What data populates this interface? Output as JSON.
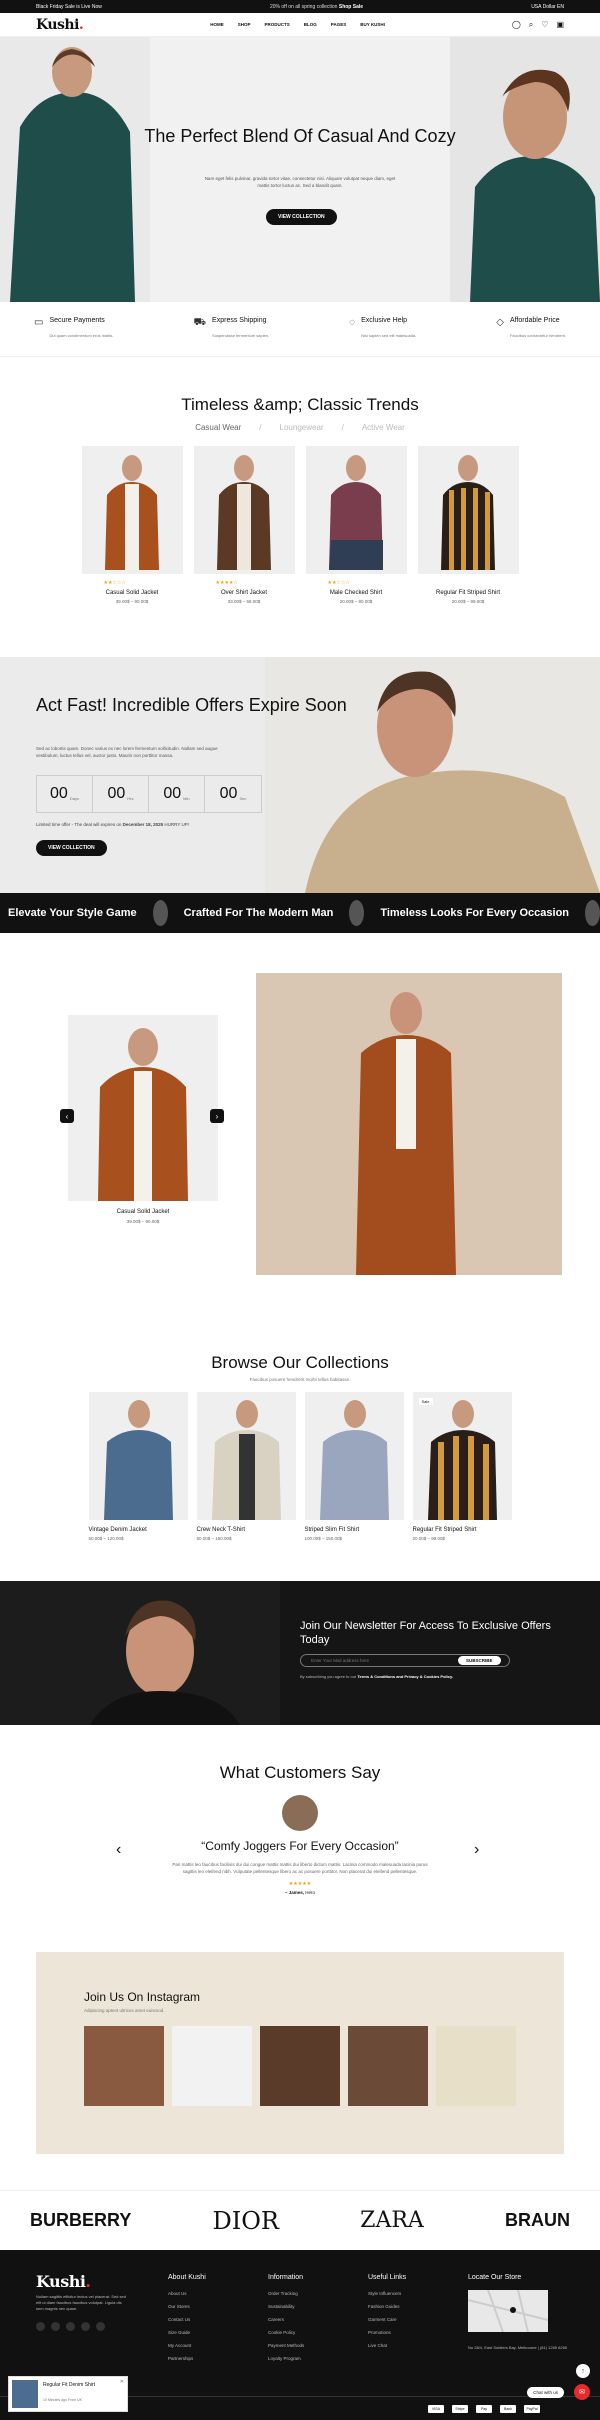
{
  "topbar": {
    "left": "Black Friday Sale is Live Now",
    "middle_pre": "20% off ",
    "middle_bold": "Shop Sale",
    "middle_rest": "on all spring collection",
    "currency": "USA Dollar",
    "language": "EN"
  },
  "nav": {
    "logo": "Kushi",
    "menu": [
      "HOME",
      "SHOP",
      "PRODUCTS",
      "BLOG",
      "PAGES",
      "BUY KUSHI"
    ]
  },
  "hero": {
    "title": "The Perfect Blend Of Casual And Cozy",
    "desc": "Nam eget felis pulvinar, gravida tortor vitae, consectetur nisi. Aliquam volutpat neque diam, eget mattis tortor luctus ac. Sed a blandit quam.",
    "button": "VIEW COLLECTION"
  },
  "features": [
    {
      "title": "Secure Payments",
      "desc": "Dui quam condimentum eros mattis.",
      "icon": "card-icon"
    },
    {
      "title": "Express Shipping",
      "desc": "Suspendisse fermentum sapien.",
      "icon": "truck-icon"
    },
    {
      "title": "Exclusive Help",
      "desc": "Nisi sapien sed elit malesuada.",
      "icon": "chat-icon"
    },
    {
      "title": "Affordable Price",
      "desc": "Faucibus consectetur hendrerit.",
      "icon": "tag-icon"
    }
  ],
  "trends": {
    "title": "Timeless &amp; Classic Trends",
    "tabs": [
      "Casual Wear",
      "Loungewear",
      "Active Wear"
    ],
    "products": [
      {
        "name": "Casual Solid Jacket",
        "price": "39.00$ – 90.00$",
        "stars": "★★☆☆☆"
      },
      {
        "name": "Over Shirt Jacket",
        "price": "33.00$ – 58.00$",
        "stars": "★★★★☆"
      },
      {
        "name": "Male Checked Shirt",
        "price": "20.00$ – 80.00$",
        "stars": "★★☆☆☆"
      },
      {
        "name": "Regular Fit Striped Shirt",
        "price": "20.00$ – 99.00$",
        "stars": ""
      }
    ]
  },
  "offer": {
    "title": "Act Fast! Incredible Offers Expire Soon",
    "desc": "Sed ac lobortis quam. Donec varius ex nec lorem fermentum sollicitudin. Nullam sed augue vestibulum, luctus tellus vel, auctor justo. Mauris non porttitor massa.",
    "timer": [
      {
        "v": "00",
        "u": "Days"
      },
      {
        "v": "00",
        "u": "Hrs"
      },
      {
        "v": "00",
        "u": "Min"
      },
      {
        "v": "00",
        "u": "Sec"
      }
    ],
    "limited_pre": "Limited time offer - The deal will expires on ",
    "limited_date": "December 18, 2025",
    "limited_post": " HURRY UP!",
    "button": "VIEW COLLECTION"
  },
  "marquee": [
    "Elevate Your Style Game",
    "Crafted For The Modern Man",
    "Timeless Looks For Every Occasion"
  ],
  "showcase": {
    "name": "Casual Solid Jacket",
    "price": "39.00$ – 90.00$"
  },
  "collections": {
    "title": "Browse Our Collections",
    "sub": "Faucibus posuere hendrerit morbi tellus habitasse.",
    "items": [
      {
        "name": "Vintage Denim Jacket",
        "price": "50.00$ – 120.00$",
        "badge": ""
      },
      {
        "name": "Crew Neck T-Shirt",
        "price": "50.00$ – 150.00$",
        "badge": ""
      },
      {
        "name": "Striped Slim Fit Shirt",
        "price": "100.00$ – 150.00$",
        "badge": ""
      },
      {
        "name": "Regular Fit Striped Shirt",
        "price": "20.00$ – 99.00$",
        "badge": "Sale"
      }
    ]
  },
  "newsletter": {
    "title": "Join Our Newsletter For Access To Exclusive Offers Today",
    "placeholder": "Enter Your Mail address here",
    "button": "SUBSCRIBE",
    "note_pre": "By subscribing you agree to our ",
    "note_bold": "Terms & Conditions and Privacy & Cookies Policy."
  },
  "testimonials": {
    "title": "What Customers Say",
    "quote": "“Comfy Joggers For Every Occasion”",
    "body": "Pan mattis leo faucibus facilisis dui dui congue mattis mattis dui liberto dictum mattis. Lacinia commodo malesuada lacinia purus sagittis leo eleifend nibh. Vulputate pellentesque libero ac ac posuere porttitor. Non placerat dui eleifend pellentesque.",
    "stars": "★★★★★",
    "name": "– James,",
    "role": " Hero"
  },
  "instagram": {
    "title": "Join Us On Instagram",
    "sub": "Adipiscing aptent ultrices amet euismod."
  },
  "brands": [
    "BURBERRY",
    "DIOR",
    "ZARA",
    "BRAUN"
  ],
  "footer": {
    "logo": "Kushi",
    "desc": "Nullam sagittis efficitur lectus vel placerat. Sed sed elit ut diam faucibus faucibus volutpat. Ligula dis sem magnis nec quam.",
    "cols": [
      {
        "title": "About Kushi",
        "links": [
          "About Us",
          "Our Stores",
          "Contact Us",
          "Size Guide",
          "My Account",
          "Partnerships"
        ]
      },
      {
        "title": "Information",
        "links": [
          "Order Tracking",
          "Sustainability",
          "Careers",
          "Cookie Policy",
          "Payment Methods",
          "Loyalty Program"
        ]
      },
      {
        "title": "Useful Links",
        "links": [
          "Style Influencers",
          "Fashion Guides",
          "Garment Care",
          "Promotions",
          "Live Chat"
        ]
      }
    ],
    "store_title": "Locate Our Store",
    "address": "No 28/4, East Soldiers Bay, Melbourne | (81) 1265 6265",
    "payments": [
      "VISA",
      "Stripe",
      "Pay",
      "Bank",
      "PayPal"
    ]
  },
  "popup": {
    "name": "Regular Fit Denim Shirt",
    "time": "10 Minutes ago From UK"
  },
  "chat": {
    "label": "Chat with us"
  }
}
